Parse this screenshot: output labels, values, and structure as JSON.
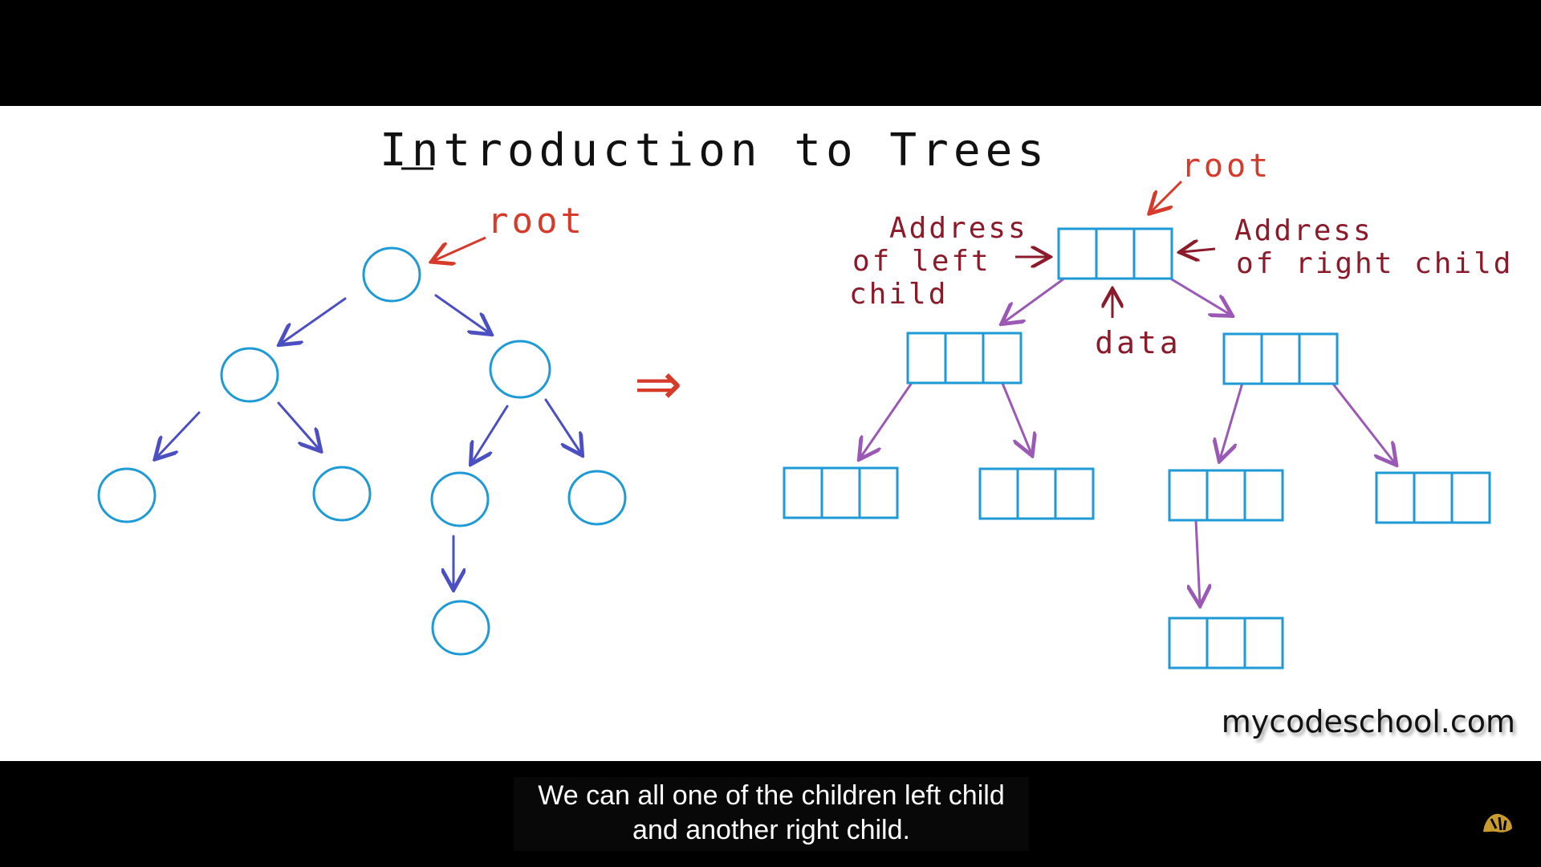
{
  "title": "Introduction to Trees",
  "labels": {
    "root_left": "root",
    "root_right": "root",
    "address_left_line1": "Address",
    "address_left_line2": "of left",
    "address_left_line3": "child",
    "address_right_line1": "Address",
    "address_right_line2": "of right child",
    "data": "data"
  },
  "arrow_symbol": "⇒",
  "watermark": "mycodeschool.com",
  "caption": {
    "line1": "We can all one of the children left child",
    "line2": "and another right child."
  },
  "colors": {
    "node": "#1e9ad6",
    "edge_left_tree": "#4b4fc2",
    "edge_right_tree": "#9b59b6",
    "annotation": "#d63a2a",
    "label_dark_red": "#8b1a2a"
  }
}
